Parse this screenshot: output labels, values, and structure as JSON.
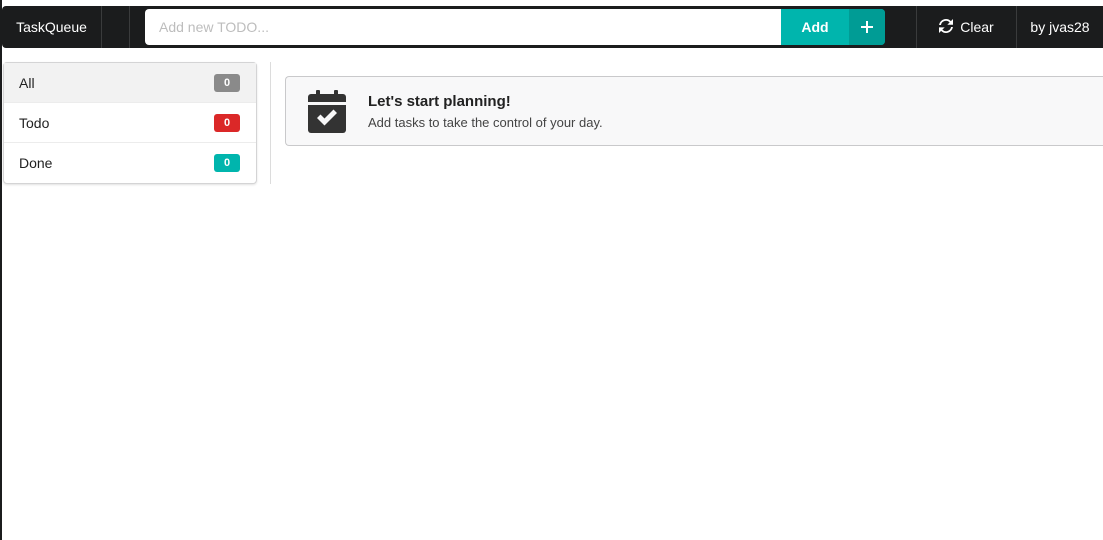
{
  "app": {
    "brand": "TaskQueue",
    "author": "by jvas28"
  },
  "input": {
    "placeholder": "Add new TODO...",
    "value": ""
  },
  "add_button": {
    "label": "Add",
    "icon": "plus-icon"
  },
  "clear_button": {
    "label": "Clear",
    "icon": "refresh-icon"
  },
  "filters": [
    {
      "label": "All",
      "count": "0",
      "color": "#8a8a8a",
      "active": true
    },
    {
      "label": "Todo",
      "count": "0",
      "color": "#db2828",
      "active": false
    },
    {
      "label": "Done",
      "count": "0",
      "color": "#00b5ad",
      "active": false
    }
  ],
  "message": {
    "icon": "calendar-check-icon",
    "header": "Let's start planning!",
    "text": "Add tasks to take the control of your day."
  },
  "colors": {
    "topbar": "#1b1c1d",
    "accent": "#00b5ad",
    "accent_dark": "#009c95"
  }
}
